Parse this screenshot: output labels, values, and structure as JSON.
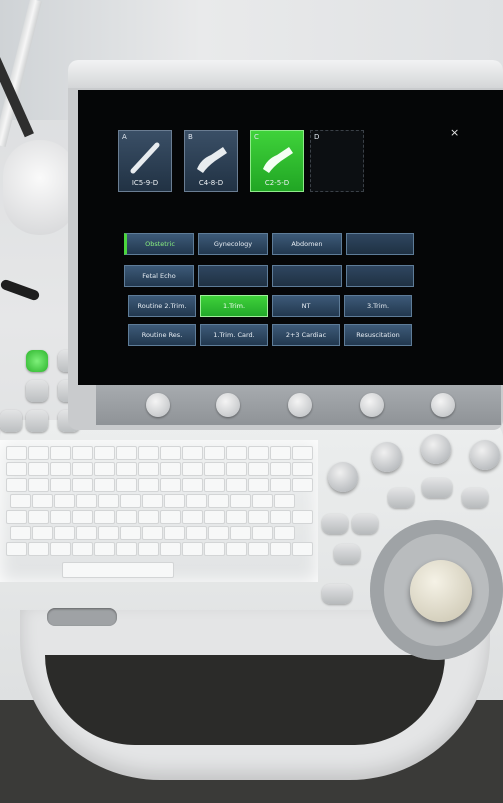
{
  "probes": [
    {
      "letter": "A",
      "name": "IC5-9-D",
      "selected": false
    },
    {
      "letter": "B",
      "name": "C4-8-D",
      "selected": false
    },
    {
      "letter": "C",
      "name": "C2-5-D",
      "selected": true
    },
    {
      "letter": "D",
      "name": "",
      "selected": false
    }
  ],
  "close_label": "×",
  "presets": {
    "row1": [
      "Obstetric",
      "Gynecology",
      "Abdomen",
      ""
    ],
    "row2": [
      "Fetal Echo",
      "",
      "",
      ""
    ],
    "row3": [
      "Routine 2.Trim.",
      "1.Trim.",
      "NT",
      "3.Trim."
    ],
    "row4": [
      "Routine Res.",
      "1.Trim. Card.",
      "2+3 Cardiac",
      "Resuscitation"
    ]
  },
  "selected_preset": "1.Trim.",
  "colors": {
    "accent_green": "#3fd23a",
    "button_blue": "#2d4866",
    "screen_bg": "#050607"
  }
}
